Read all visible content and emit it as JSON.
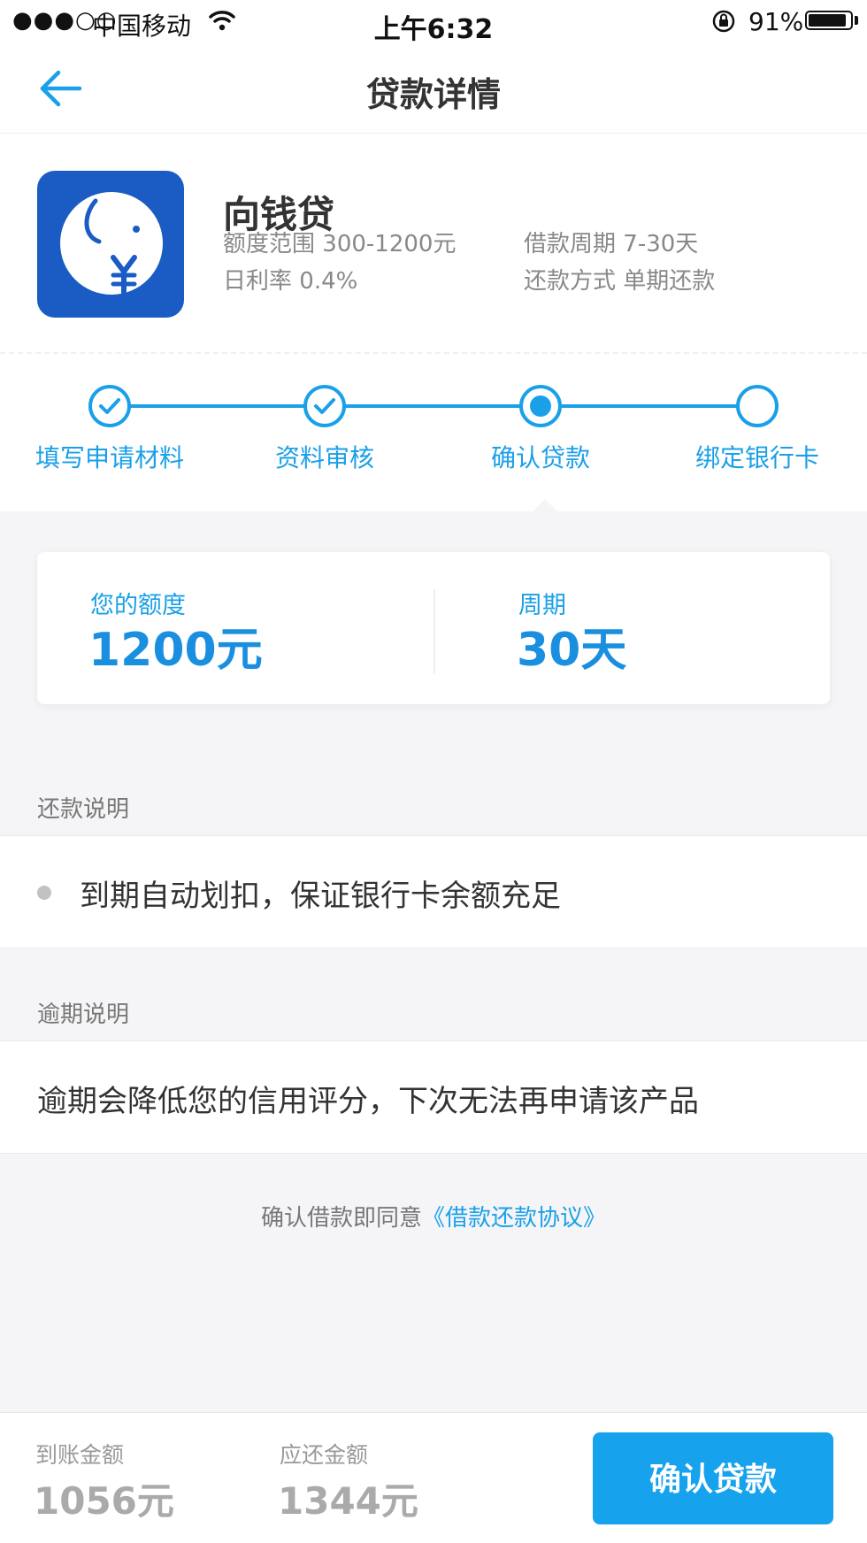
{
  "status_bar": {
    "signal": "●●●○○",
    "carrier": "中国移动",
    "time": "上午6:32",
    "battery": "91%",
    "battery_level": 0.91
  },
  "nav": {
    "title": "贷款详情",
    "back_icon": "arrow-left-icon"
  },
  "product": {
    "name": "向钱贷",
    "specs": [
      {
        "label": "额度范围",
        "value": "300-1200元"
      },
      {
        "label": "借款周期",
        "value": "7-30天"
      },
      {
        "label": "日利率",
        "value": "0.4%"
      },
      {
        "label": "还款方式",
        "value": "单期还款"
      }
    ]
  },
  "steps": [
    {
      "label": "填写申请材料",
      "state": "done"
    },
    {
      "label": "资料审核",
      "state": "done"
    },
    {
      "label": "确认贷款",
      "state": "current"
    },
    {
      "label": "绑定银行卡",
      "state": "todo"
    }
  ],
  "quota": {
    "limit_label": "您的额度",
    "limit_value": "1200元",
    "period_label": "周期",
    "period_value": "30天"
  },
  "repayment": {
    "title": "还款说明",
    "text": "到期自动划扣，保证银行卡余额充足"
  },
  "overdue": {
    "title": "逾期说明",
    "text": "逾期会降低您的信用评分，下次无法再申请该产品"
  },
  "agreement": {
    "prefix": "确认借款即同意",
    "link": "《借款还款协议》"
  },
  "bottom": {
    "received_label": "到账金额",
    "received_value": "1056元",
    "repay_label": "应还金额",
    "repay_value": "1344元",
    "confirm_label": "确认贷款"
  },
  "colors": {
    "accent": "#1aa0e8",
    "button": "#16a2ec",
    "icon_bg": "#1a5cc4"
  }
}
